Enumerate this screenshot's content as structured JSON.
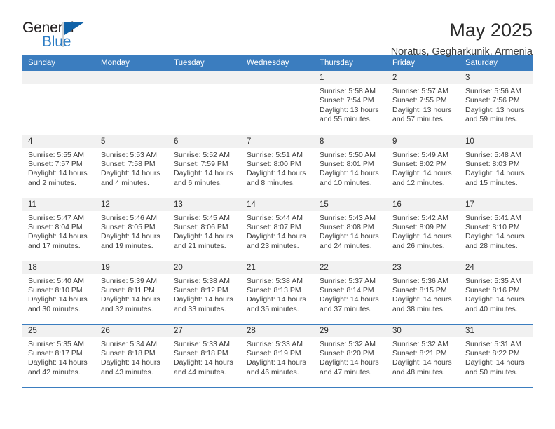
{
  "logo": {
    "word_top": "General",
    "word_bottom": "Blue",
    "accent_color": "#1263a8",
    "text_color": "#231f20"
  },
  "header": {
    "title": "May 2025",
    "subtitle": "Noratus, Gegharkunik, Armenia"
  },
  "theme": {
    "header_bar": "#3b7dbf",
    "daynum_band": "#f1f1f1",
    "body_text": "#3c3c3c"
  },
  "labels": {
    "sunrise": "Sunrise:",
    "sunset": "Sunset:",
    "daylight": "Daylight:"
  },
  "weekdays": [
    "Sunday",
    "Monday",
    "Tuesday",
    "Wednesday",
    "Thursday",
    "Friday",
    "Saturday"
  ],
  "weeks": [
    [
      {
        "day": "",
        "empty": true
      },
      {
        "day": "",
        "empty": true
      },
      {
        "day": "",
        "empty": true
      },
      {
        "day": "",
        "empty": true
      },
      {
        "day": "1",
        "sunrise": "Sunrise: 5:58 AM",
        "sunset": "Sunset: 7:54 PM",
        "daylight": "Daylight: 13 hours and 55 minutes."
      },
      {
        "day": "2",
        "sunrise": "Sunrise: 5:57 AM",
        "sunset": "Sunset: 7:55 PM",
        "daylight": "Daylight: 13 hours and 57 minutes."
      },
      {
        "day": "3",
        "sunrise": "Sunrise: 5:56 AM",
        "sunset": "Sunset: 7:56 PM",
        "daylight": "Daylight: 13 hours and 59 minutes."
      }
    ],
    [
      {
        "day": "4",
        "sunrise": "Sunrise: 5:55 AM",
        "sunset": "Sunset: 7:57 PM",
        "daylight": "Daylight: 14 hours and 2 minutes."
      },
      {
        "day": "5",
        "sunrise": "Sunrise: 5:53 AM",
        "sunset": "Sunset: 7:58 PM",
        "daylight": "Daylight: 14 hours and 4 minutes."
      },
      {
        "day": "6",
        "sunrise": "Sunrise: 5:52 AM",
        "sunset": "Sunset: 7:59 PM",
        "daylight": "Daylight: 14 hours and 6 minutes."
      },
      {
        "day": "7",
        "sunrise": "Sunrise: 5:51 AM",
        "sunset": "Sunset: 8:00 PM",
        "daylight": "Daylight: 14 hours and 8 minutes."
      },
      {
        "day": "8",
        "sunrise": "Sunrise: 5:50 AM",
        "sunset": "Sunset: 8:01 PM",
        "daylight": "Daylight: 14 hours and 10 minutes."
      },
      {
        "day": "9",
        "sunrise": "Sunrise: 5:49 AM",
        "sunset": "Sunset: 8:02 PM",
        "daylight": "Daylight: 14 hours and 12 minutes."
      },
      {
        "day": "10",
        "sunrise": "Sunrise: 5:48 AM",
        "sunset": "Sunset: 8:03 PM",
        "daylight": "Daylight: 14 hours and 15 minutes."
      }
    ],
    [
      {
        "day": "11",
        "sunrise": "Sunrise: 5:47 AM",
        "sunset": "Sunset: 8:04 PM",
        "daylight": "Daylight: 14 hours and 17 minutes."
      },
      {
        "day": "12",
        "sunrise": "Sunrise: 5:46 AM",
        "sunset": "Sunset: 8:05 PM",
        "daylight": "Daylight: 14 hours and 19 minutes."
      },
      {
        "day": "13",
        "sunrise": "Sunrise: 5:45 AM",
        "sunset": "Sunset: 8:06 PM",
        "daylight": "Daylight: 14 hours and 21 minutes."
      },
      {
        "day": "14",
        "sunrise": "Sunrise: 5:44 AM",
        "sunset": "Sunset: 8:07 PM",
        "daylight": "Daylight: 14 hours and 23 minutes."
      },
      {
        "day": "15",
        "sunrise": "Sunrise: 5:43 AM",
        "sunset": "Sunset: 8:08 PM",
        "daylight": "Daylight: 14 hours and 24 minutes."
      },
      {
        "day": "16",
        "sunrise": "Sunrise: 5:42 AM",
        "sunset": "Sunset: 8:09 PM",
        "daylight": "Daylight: 14 hours and 26 minutes."
      },
      {
        "day": "17",
        "sunrise": "Sunrise: 5:41 AM",
        "sunset": "Sunset: 8:10 PM",
        "daylight": "Daylight: 14 hours and 28 minutes."
      }
    ],
    [
      {
        "day": "18",
        "sunrise": "Sunrise: 5:40 AM",
        "sunset": "Sunset: 8:10 PM",
        "daylight": "Daylight: 14 hours and 30 minutes."
      },
      {
        "day": "19",
        "sunrise": "Sunrise: 5:39 AM",
        "sunset": "Sunset: 8:11 PM",
        "daylight": "Daylight: 14 hours and 32 minutes."
      },
      {
        "day": "20",
        "sunrise": "Sunrise: 5:38 AM",
        "sunset": "Sunset: 8:12 PM",
        "daylight": "Daylight: 14 hours and 33 minutes."
      },
      {
        "day": "21",
        "sunrise": "Sunrise: 5:38 AM",
        "sunset": "Sunset: 8:13 PM",
        "daylight": "Daylight: 14 hours and 35 minutes."
      },
      {
        "day": "22",
        "sunrise": "Sunrise: 5:37 AM",
        "sunset": "Sunset: 8:14 PM",
        "daylight": "Daylight: 14 hours and 37 minutes."
      },
      {
        "day": "23",
        "sunrise": "Sunrise: 5:36 AM",
        "sunset": "Sunset: 8:15 PM",
        "daylight": "Daylight: 14 hours and 38 minutes."
      },
      {
        "day": "24",
        "sunrise": "Sunrise: 5:35 AM",
        "sunset": "Sunset: 8:16 PM",
        "daylight": "Daylight: 14 hours and 40 minutes."
      }
    ],
    [
      {
        "day": "25",
        "sunrise": "Sunrise: 5:35 AM",
        "sunset": "Sunset: 8:17 PM",
        "daylight": "Daylight: 14 hours and 42 minutes."
      },
      {
        "day": "26",
        "sunrise": "Sunrise: 5:34 AM",
        "sunset": "Sunset: 8:18 PM",
        "daylight": "Daylight: 14 hours and 43 minutes."
      },
      {
        "day": "27",
        "sunrise": "Sunrise: 5:33 AM",
        "sunset": "Sunset: 8:18 PM",
        "daylight": "Daylight: 14 hours and 44 minutes."
      },
      {
        "day": "28",
        "sunrise": "Sunrise: 5:33 AM",
        "sunset": "Sunset: 8:19 PM",
        "daylight": "Daylight: 14 hours and 46 minutes."
      },
      {
        "day": "29",
        "sunrise": "Sunrise: 5:32 AM",
        "sunset": "Sunset: 8:20 PM",
        "daylight": "Daylight: 14 hours and 47 minutes."
      },
      {
        "day": "30",
        "sunrise": "Sunrise: 5:32 AM",
        "sunset": "Sunset: 8:21 PM",
        "daylight": "Daylight: 14 hours and 48 minutes."
      },
      {
        "day": "31",
        "sunrise": "Sunrise: 5:31 AM",
        "sunset": "Sunset: 8:22 PM",
        "daylight": "Daylight: 14 hours and 50 minutes."
      }
    ]
  ]
}
